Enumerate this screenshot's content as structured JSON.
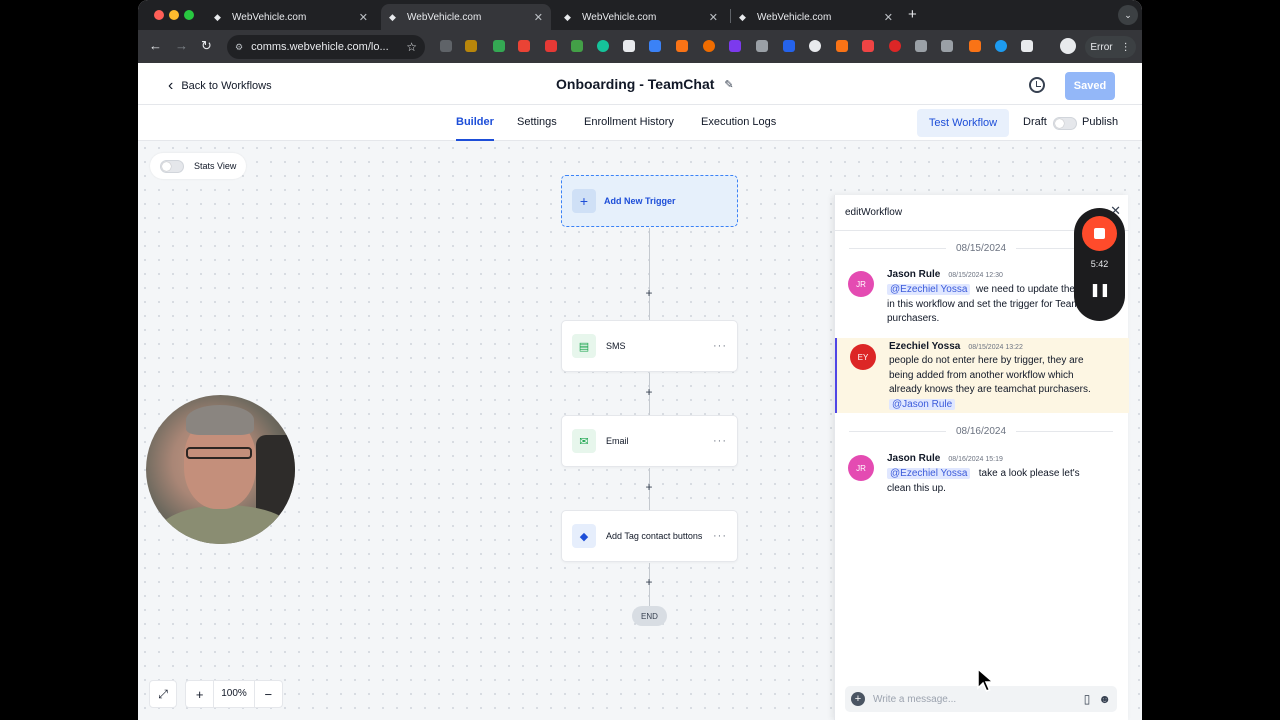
{
  "browser": {
    "tabs": [
      {
        "title": "WebVehicle.com",
        "active": false
      },
      {
        "title": "WebVehicle.com",
        "active": true
      },
      {
        "title": "WebVehicle.com",
        "active": false
      },
      {
        "title": "WebVehicle.com",
        "active": false
      }
    ],
    "url": "comms.webvehicle.com/lo...",
    "error_label": "Error",
    "colors": {
      "tab_bg": "#202124",
      "toolbar_bg": "#35363a"
    }
  },
  "header": {
    "back_label": "Back to Workflows",
    "workflow_title": "Onboarding - TeamChat",
    "saved_label": "Saved"
  },
  "nav": {
    "tabs": [
      "Builder",
      "Settings",
      "Enrollment History",
      "Execution Logs"
    ],
    "active_tab": "Builder",
    "test_label": "Test Workflow",
    "draft_label": "Draft",
    "publish_label": "Publish"
  },
  "canvas": {
    "stats_label": "Stats View",
    "trigger_label": "Add New Trigger",
    "nodes": [
      {
        "label": "SMS",
        "icon": "sms-icon",
        "color": "#16a34a"
      },
      {
        "label": "Email",
        "icon": "email-icon",
        "color": "#16a34a"
      },
      {
        "label": "Add Tag contact buttons",
        "icon": "tag-icon",
        "color": "#1d4ed8"
      }
    ],
    "end_label": "END",
    "zoom": "100%",
    "plus_glyph": "+",
    "zoom_in": "+",
    "zoom_out": "−"
  },
  "chat": {
    "title": "editWorkflow",
    "date1": "08/15/2024",
    "date2": "08/16/2024",
    "messages": [
      {
        "initials": "JR",
        "author": "Jason Rule",
        "time": "08/15/2024 12:30",
        "mention": "@Ezechiel Yossa",
        "text": "we need to update the content in this workflow and set the trigger for TeamChat purchasers."
      },
      {
        "initials": "EY",
        "author": "Ezechiel Yossa",
        "time": "08/15/2024 13:22",
        "text": "people do not enter here by trigger, they are being added from another workflow which already knows they are teamchat purchasers.",
        "mention": "@Jason Rule"
      },
      {
        "initials": "JR",
        "author": "Jason Rule",
        "time": "08/16/2024 15:19",
        "mention": "@Ezechiel Yossa",
        "text": "take a look please let's clean this up."
      }
    ],
    "placeholder": "Write a message...",
    "colors": {
      "jr_avatar": "#e44bb2",
      "ey_avatar": "#dc2626",
      "mention_bg": "#e0e7ff",
      "highlight_bg": "#fdf6e3"
    }
  },
  "recorder": {
    "elapsed": "5:42"
  }
}
